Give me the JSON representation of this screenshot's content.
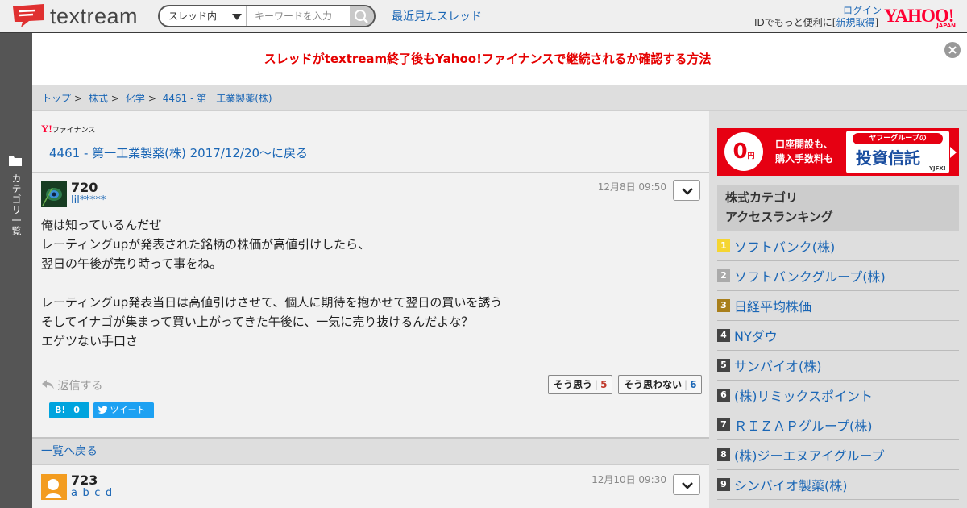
{
  "header": {
    "logo_text": "textream",
    "search_scope": "スレッド内",
    "search_placeholder": "キーワードを入力",
    "recent_threads": "最近見たスレッド",
    "login": "ログイン",
    "id_prefix": "IDでもっと便利に[",
    "register": "新規取得",
    "id_suffix": "]",
    "yahoo_logo": "YAHOO!",
    "yahoo_japan": "JAPAN"
  },
  "sidebar": {
    "label": "カテゴリ一覧"
  },
  "notice": {
    "text": "スレッドがtextream終了後もYahoo!ファイナンスで継続されるか確認する方法"
  },
  "breadcrumb": [
    "トップ",
    "株式",
    "化学",
    "4461 - 第一工業製薬(株)"
  ],
  "breadcrumb_sep": ">",
  "finance_logo": {
    "mark": "Y!",
    "text": "ファイナンス"
  },
  "back_link": "4461 - 第一工業製薬(株) 2017/12/20〜に戻る",
  "posts": [
    {
      "number": "720",
      "user": "lil*****",
      "date": "12月8日 09:50",
      "lines": [
        "俺は知っているんだぜ",
        "レーティングupが発表された銘柄の株価が高値引けしたら、",
        "翌日の午後が売り時って事をね。",
        "",
        "レーティングup発表当日は高値引けさせて、個人に期待を抱かせて翌日の買いを誘う",
        "そしてイナゴが集まって買い上がってきた午後に、一気に売り抜けるんだよな？",
        "エゲツない手口さ"
      ],
      "reply": "返信する",
      "agree_label": "そう思う",
      "agree_count": "5",
      "disagree_label": "そう思わない",
      "disagree_count": "6",
      "hatena_label": "B!",
      "hatena_count": "0",
      "tweet_label": "ツイート"
    },
    {
      "number": "723",
      "user": "a_b_c_d",
      "date": "12月10日 09:30"
    }
  ],
  "list_back": "一覧へ戻る",
  "ad": {
    "zero": "0",
    "yen": "円",
    "line1": "口座開設も、",
    "line2": "購入手数料も",
    "tag": "ヤフーグループの",
    "main": "投資信託",
    "sub": "YJFX!"
  },
  "ranking": {
    "title_line1": "株式カテゴリ",
    "title_line2": "アクセスランキング",
    "items": [
      {
        "rank": "1",
        "name": "ソフトバンク(株)"
      },
      {
        "rank": "2",
        "name": "ソフトバンクグループ(株)"
      },
      {
        "rank": "3",
        "name": "日経平均株価"
      },
      {
        "rank": "4",
        "name": "NYダウ"
      },
      {
        "rank": "5",
        "name": "サンバイオ(株)"
      },
      {
        "rank": "6",
        "name": "(株)リミックスポイント"
      },
      {
        "rank": "7",
        "name": "ＲＩＺＡＰグループ(株)"
      },
      {
        "rank": "8",
        "name": "(株)ジーエヌアイグループ"
      },
      {
        "rank": "9",
        "name": "シンバイオ製薬(株)"
      }
    ],
    "badge_colors": [
      "#f5d531",
      "#aaaaaa",
      "#a87f1c",
      "#444444",
      "#444444",
      "#444444",
      "#444444",
      "#444444",
      "#444444"
    ]
  },
  "colors": {
    "accent_red": "#e60012",
    "link_blue": "#1a66b5",
    "logo_red": "#e03030"
  },
  "icons": [
    "speech-bubble-logo-icon",
    "chevron-down-icon",
    "search-icon",
    "folder-icon",
    "close-icon",
    "reply-arrow-icon",
    "twitter-bird-icon",
    "ad-arrow-icon"
  ]
}
